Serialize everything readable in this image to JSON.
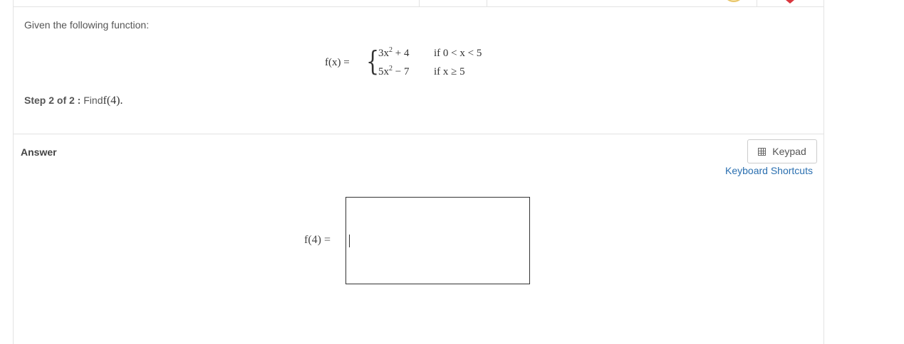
{
  "prompt": "Given the following function:",
  "function": {
    "label": "f(x) =",
    "cases": [
      {
        "expr_base": "3x",
        "expr_exp": "2",
        "expr_tail": " + 4",
        "condition": "if 0 < x < 5"
      },
      {
        "expr_base": "5x",
        "expr_exp": "2",
        "expr_tail": " − 7",
        "condition": "if x ≥ 5"
      }
    ]
  },
  "step": {
    "label": "Step 2 of 2 :",
    "instruction": "Find",
    "expression": "f(4)."
  },
  "answer": {
    "label": "Answer",
    "equation_label": "f(4) =",
    "input_value": ""
  },
  "toolbar": {
    "keypad_label": "Keypad",
    "keypad_icon": "calculator-icon",
    "shortcuts_label": "Keyboard Shortcuts"
  },
  "colors": {
    "link": "#2a6fb0",
    "text": "#555555",
    "border": "#e3e3e3"
  }
}
